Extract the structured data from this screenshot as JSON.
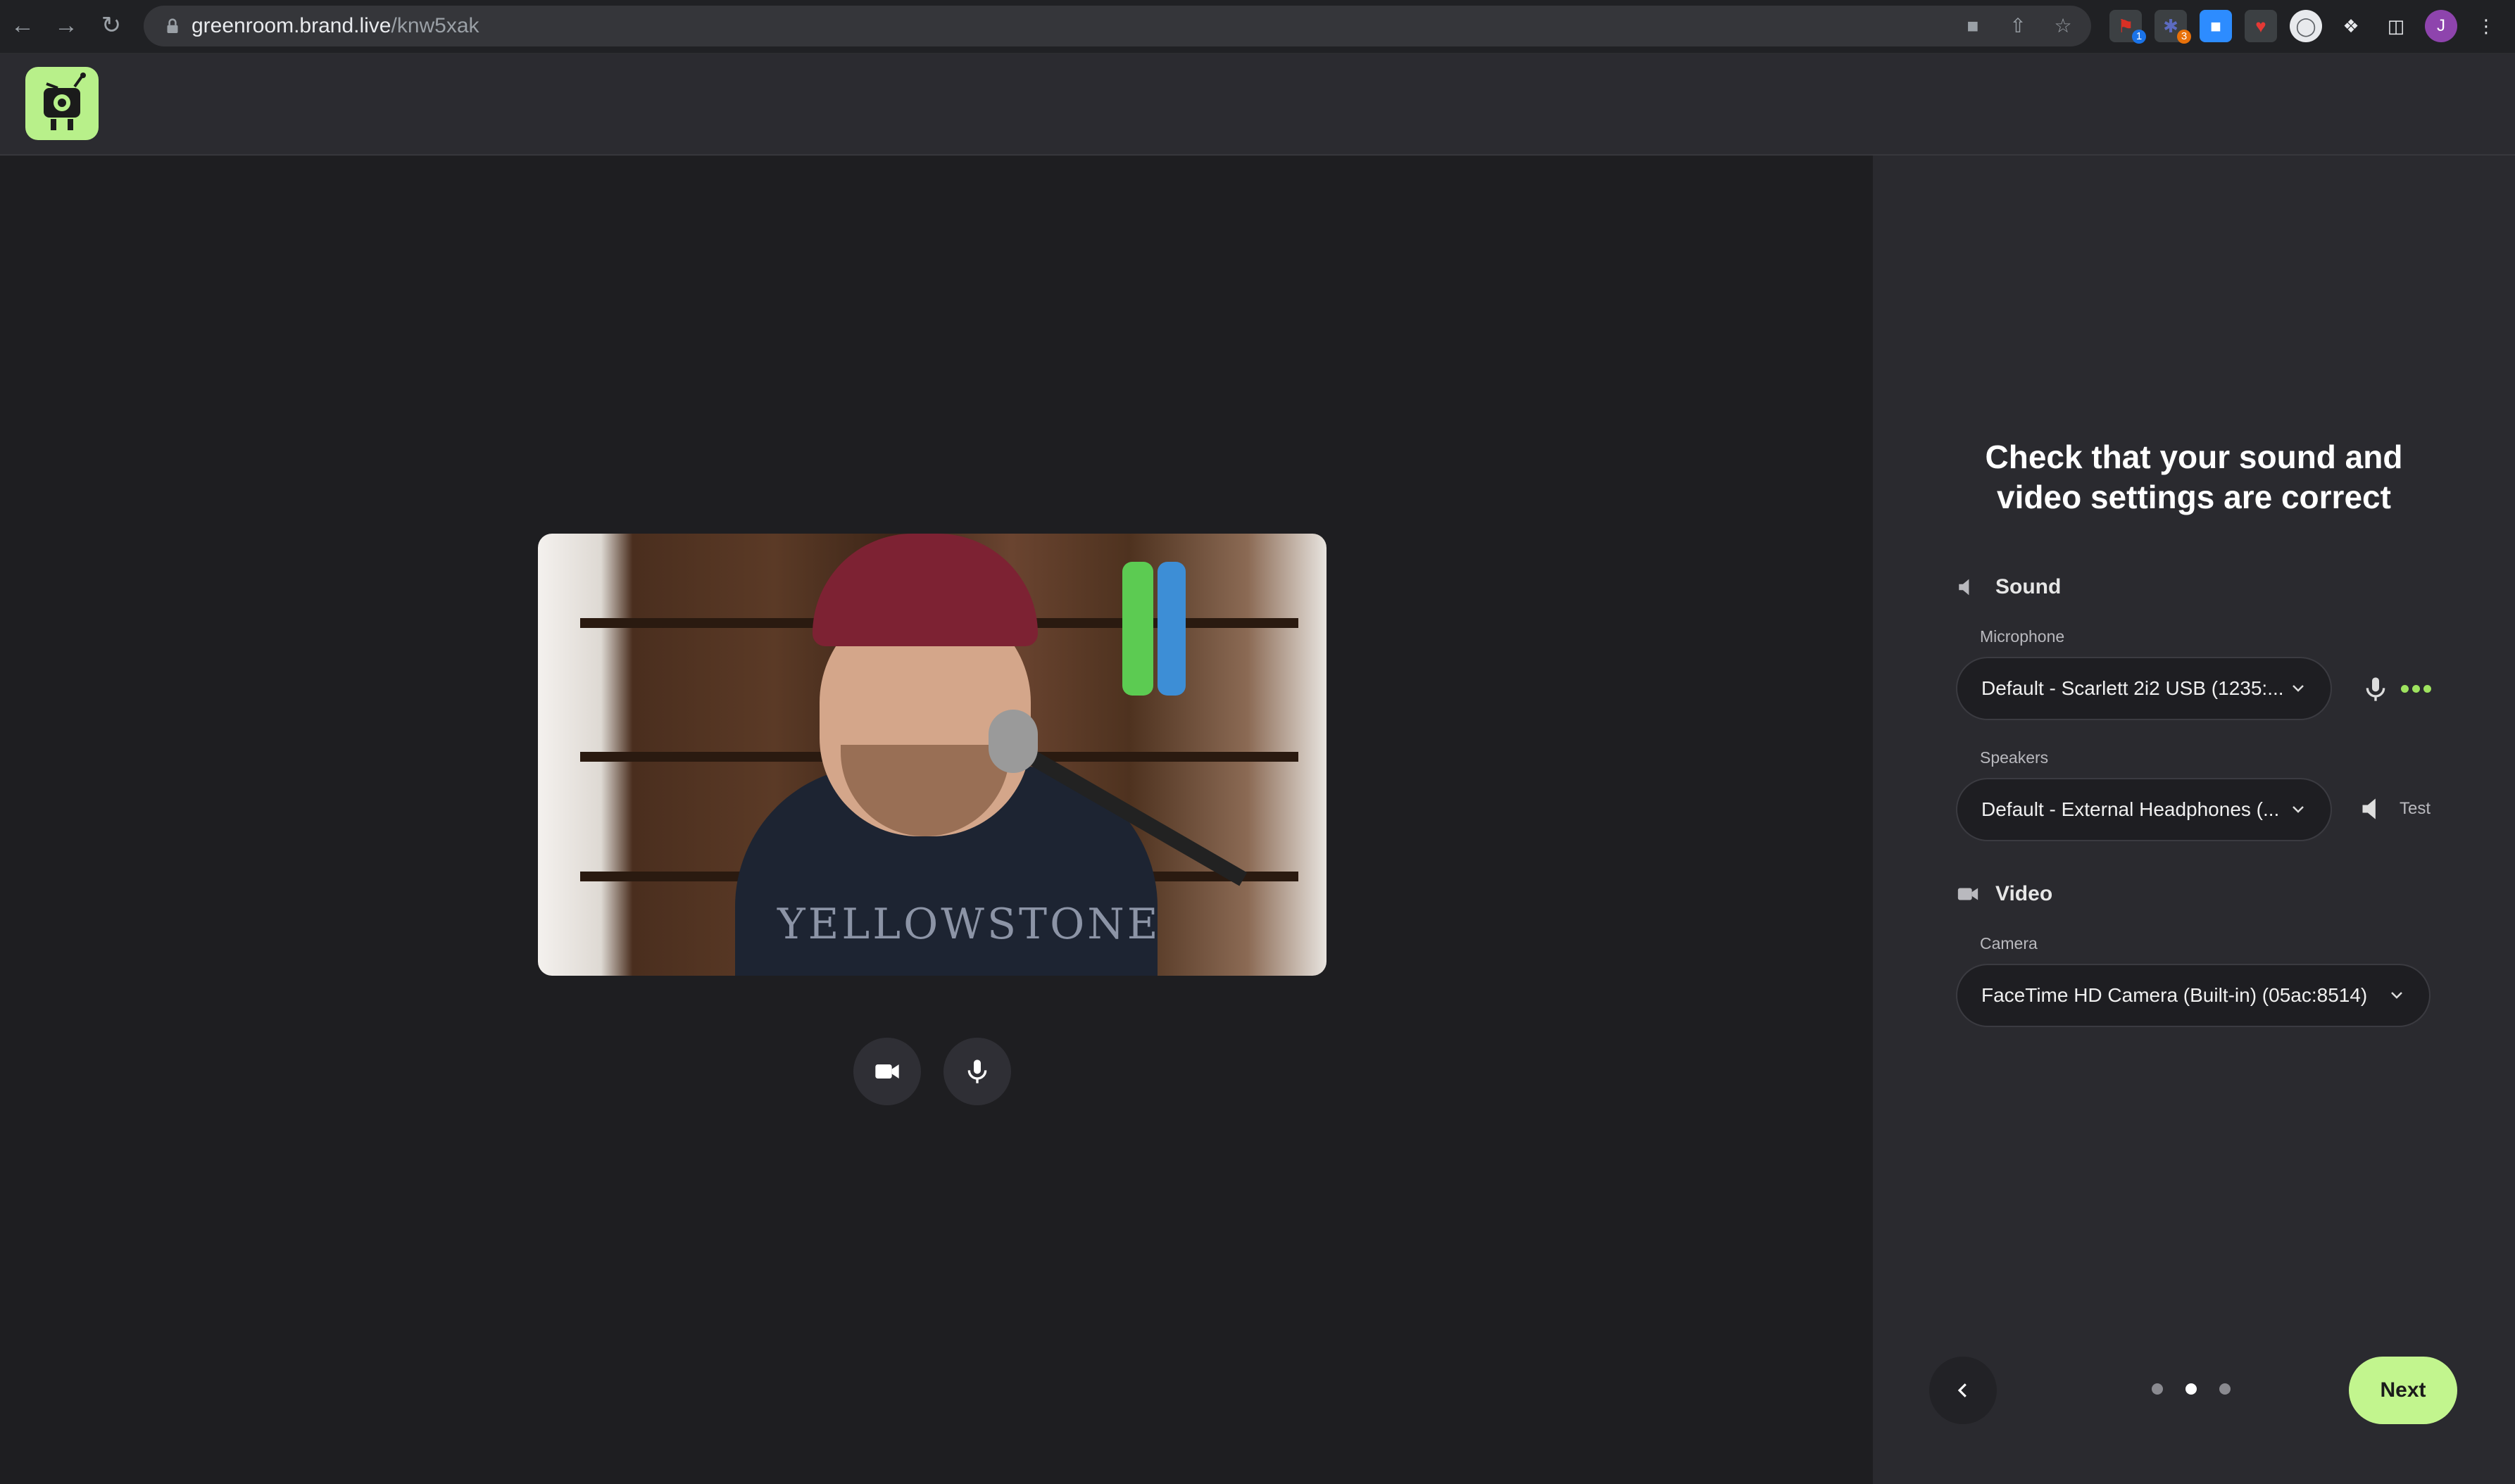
{
  "browser": {
    "url_host": "greenroom.brand.live",
    "url_path": "/knw5xak",
    "extensions": [
      {
        "name": "ext-1",
        "badge": "1",
        "color": "#d93025",
        "badge_color": "#1a73e8"
      },
      {
        "name": "ext-2",
        "badge": "3",
        "color": "#5c6bc0",
        "badge_color": "#e8710a"
      },
      {
        "name": "zoom",
        "badge": "",
        "color": "#2d8cff"
      },
      {
        "name": "ext-4",
        "badge": "",
        "color": "#e53935"
      },
      {
        "name": "ext-5",
        "badge": "",
        "color": "#e8eaed"
      }
    ],
    "profile_initial": "J"
  },
  "panel": {
    "title_line1": "Check that your sound and",
    "title_line2": "video settings are correct",
    "sound": {
      "heading": "Sound",
      "microphone_label": "Microphone",
      "microphone_value": "Default - Scarlett 2i2 USB (1235:...",
      "speakers_label": "Speakers",
      "speakers_value": "Default - External Headphones (...",
      "test_label": "Test",
      "level_color": "#9ee35f"
    },
    "video": {
      "heading": "Video",
      "camera_label": "Camera",
      "camera_value": "FaceTime HD Camera (Built-in) (05ac:8514)"
    },
    "pager": {
      "total": 3,
      "current": 2,
      "next_label": "Next"
    }
  },
  "preview": {
    "shirt_text": "YELLOWSTONE"
  },
  "colors": {
    "accent": "#c2f58e",
    "logo_bg": "#b8f08a",
    "panel_bg": "#2a2a2f",
    "stage_bg": "#1e1e21"
  }
}
